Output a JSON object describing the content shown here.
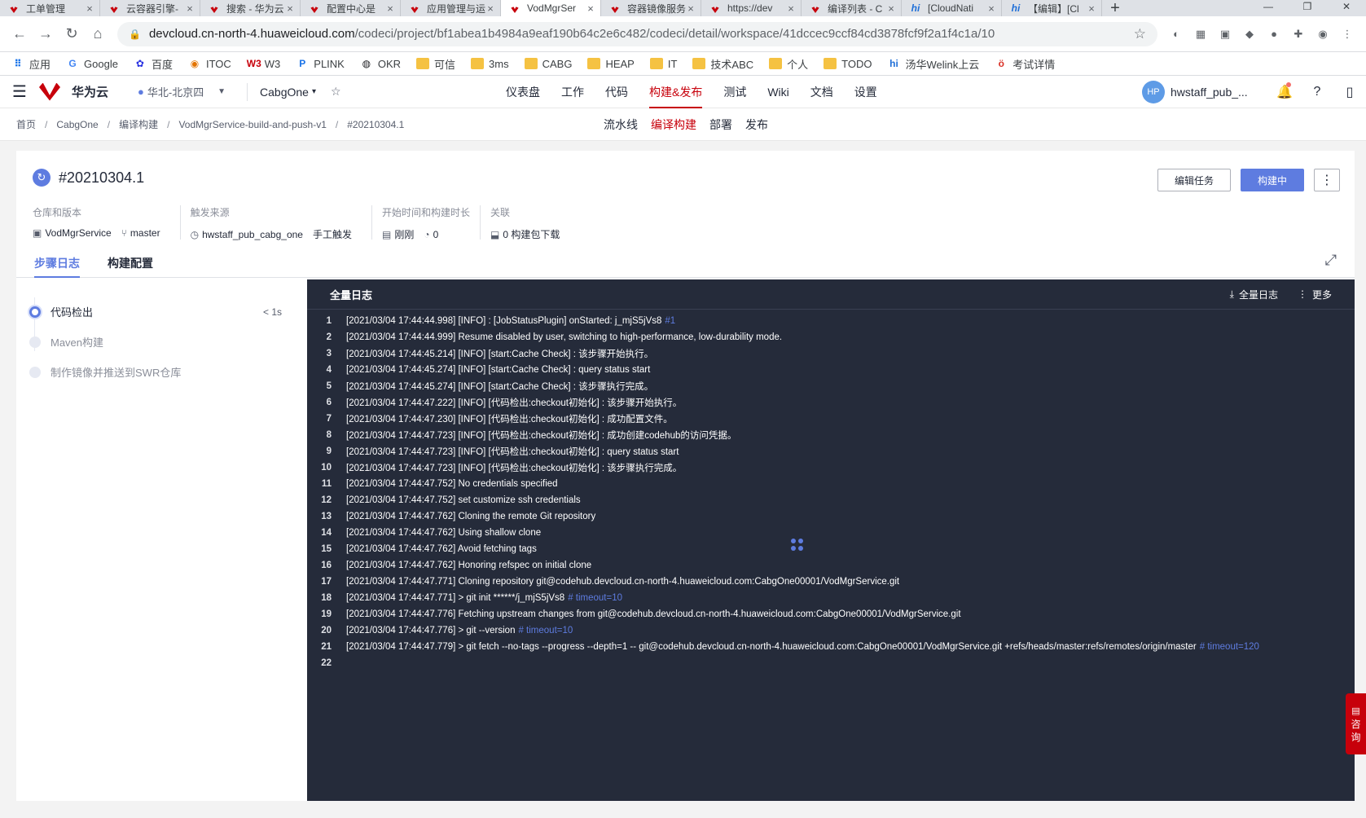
{
  "browser": {
    "tabs": [
      {
        "title": "工单管理",
        "icon": "hw",
        "active": false
      },
      {
        "title": "云容器引擎-",
        "icon": "hw",
        "active": false
      },
      {
        "title": "搜索 - 华为云",
        "icon": "hw",
        "active": false
      },
      {
        "title": "配置中心是",
        "icon": "hw",
        "active": false
      },
      {
        "title": "应用管理与运",
        "icon": "hw",
        "active": false
      },
      {
        "title": "VodMgrSer",
        "icon": "hw",
        "active": true
      },
      {
        "title": "容器镜像服务",
        "icon": "hw",
        "active": false
      },
      {
        "title": "https://dev",
        "icon": "hw",
        "active": false
      },
      {
        "title": "编译列表 - C",
        "icon": "hw",
        "active": false
      },
      {
        "title": "[CloudNati",
        "icon": "hi",
        "active": false
      },
      {
        "title": "【编辑】[Cl",
        "icon": "hi",
        "active": false
      }
    ],
    "url_domain": "devcloud.cn-north-4.huaweicloud.com",
    "url_path": "/codeci/project/bf1abea1b4984a9eaf190b64c2e6c482/codeci/detail/workspace/41dccec9ccf84cd3878fcf9f2a1f4c1a/10",
    "bookmarks": [
      {
        "label": "应用",
        "icon": "apps"
      },
      {
        "label": "Google",
        "icon": "G"
      },
      {
        "label": "百度",
        "icon": "baidu"
      },
      {
        "label": "ITOC",
        "icon": "itoc"
      },
      {
        "label": "W3",
        "icon": "W3"
      },
      {
        "label": "PLINK",
        "icon": "P"
      },
      {
        "label": "OKR",
        "icon": "okr"
      },
      {
        "label": "可信",
        "icon": "folder"
      },
      {
        "label": "3ms",
        "icon": "folder"
      },
      {
        "label": "CABG",
        "icon": "folder"
      },
      {
        "label": "HEAP",
        "icon": "folder"
      },
      {
        "label": "IT",
        "icon": "folder"
      },
      {
        "label": "技术ABC",
        "icon": "folder"
      },
      {
        "label": "个人",
        "icon": "folder"
      },
      {
        "label": "TODO",
        "icon": "folder"
      },
      {
        "label": "汤华Welink上云",
        "icon": "hi"
      },
      {
        "label": "考试详情",
        "icon": "exam"
      }
    ]
  },
  "appbar": {
    "brand": "华为云",
    "region": "华北-北京四",
    "project": "CabgOne",
    "nav": [
      "仪表盘",
      "工作",
      "代码",
      "构建&发布",
      "测试",
      "Wiki",
      "文档",
      "设置"
    ],
    "active_nav": "构建&发布",
    "avatar": "HP",
    "user": "hwstaff_pub_..."
  },
  "breadcrumb": [
    "首页",
    "CabgOne",
    "编译构建",
    "VodMgrService-build-and-push-v1",
    "#20210304.1"
  ],
  "subnav": [
    "流水线",
    "编译构建",
    "部署",
    "发布"
  ],
  "build": {
    "number": "#20210304.1",
    "edit_label": "编辑任务",
    "status_label": "构建中",
    "meta": {
      "repo_label": "仓库和版本",
      "repo": "VodMgrService",
      "branch": "master",
      "trigger_label": "触发来源",
      "trigger_user": "hwstaff_pub_cabg_one",
      "trigger_type": "手工触发",
      "time_label": "开始时间和构建时长",
      "start": "刚刚",
      "duration": "0",
      "assoc_label": "关联",
      "artifacts": "0 构建包下载"
    },
    "tabs": [
      "步骤日志",
      "构建配置"
    ],
    "steps": [
      {
        "name": "代码检出",
        "duration": "< 1s",
        "state": "running"
      },
      {
        "name": "Maven构建",
        "duration": "",
        "state": "pending"
      },
      {
        "name": "制作镜像并推送到SWR仓库",
        "duration": "",
        "state": "pending"
      }
    ]
  },
  "log": {
    "title": "全量日志",
    "download_label": "全量日志",
    "more_label": "更多",
    "lines": [
      {
        "n": "1",
        "text": "[2021/03/04 17:44:44.998] [INFO]  : [JobStatusPlugin] onStarted: j_mjS5jVs8",
        "comment": "#1"
      },
      {
        "n": "2",
        "text": "[2021/03/04 17:44:44.999] Resume disabled by user, switching to high-performance, low-durability mode.",
        "comment": ""
      },
      {
        "n": "3",
        "text": "[2021/03/04 17:44:45.214] [INFO] [start:Cache Check] : 该步骤开始执行。",
        "comment": ""
      },
      {
        "n": "4",
        "text": "[2021/03/04 17:44:45.274] [INFO] [start:Cache Check] : query status start",
        "comment": ""
      },
      {
        "n": "5",
        "text": "[2021/03/04 17:44:45.274] [INFO] [start:Cache Check] : 该步骤执行完成。",
        "comment": ""
      },
      {
        "n": "6",
        "text": "[2021/03/04 17:44:47.222] [INFO] [代码检出:checkout初始化] : 该步骤开始执行。",
        "comment": ""
      },
      {
        "n": "7",
        "text": "[2021/03/04 17:44:47.230] [INFO] [代码检出:checkout初始化] : 成功配置文件。",
        "comment": ""
      },
      {
        "n": "8",
        "text": "[2021/03/04 17:44:47.723] [INFO] [代码检出:checkout初始化] : 成功创建codehub的访问凭据。",
        "comment": ""
      },
      {
        "n": "9",
        "text": "[2021/03/04 17:44:47.723] [INFO] [代码检出:checkout初始化] : query status start",
        "comment": ""
      },
      {
        "n": "10",
        "text": "[2021/03/04 17:44:47.723] [INFO] [代码检出:checkout初始化] : 该步骤执行完成。",
        "comment": ""
      },
      {
        "n": "11",
        "text": "[2021/03/04 17:44:47.752] No credentials specified",
        "comment": ""
      },
      {
        "n": "12",
        "text": "[2021/03/04 17:44:47.752] set customize ssh credentials",
        "comment": ""
      },
      {
        "n": "13",
        "text": "[2021/03/04 17:44:47.762] Cloning the remote Git repository",
        "comment": ""
      },
      {
        "n": "14",
        "text": "[2021/03/04 17:44:47.762] Using shallow clone",
        "comment": ""
      },
      {
        "n": "15",
        "text": "[2021/03/04 17:44:47.762] Avoid fetching tags",
        "comment": ""
      },
      {
        "n": "16",
        "text": "[2021/03/04 17:44:47.762] Honoring refspec on initial clone",
        "comment": ""
      },
      {
        "n": "17",
        "text": "[2021/03/04 17:44:47.771] Cloning repository git@codehub.devcloud.cn-north-4.huaweicloud.com:CabgOne00001/VodMgrService.git",
        "comment": ""
      },
      {
        "n": "18",
        "text": "[2021/03/04 17:44:47.771]  > git init ******/j_mjS5jVs8",
        "comment": "# timeout=10"
      },
      {
        "n": "19",
        "text": "[2021/03/04 17:44:47.776] Fetching upstream changes from git@codehub.devcloud.cn-north-4.huaweicloud.com:CabgOne00001/VodMgrService.git",
        "comment": ""
      },
      {
        "n": "20",
        "text": "[2021/03/04 17:44:47.776]  > git --version",
        "comment": "# timeout=10"
      },
      {
        "n": "21",
        "text": "[2021/03/04 17:44:47.779]  > git fetch --no-tags --progress --depth=1 -- git@codehub.devcloud.cn-north-4.huaweicloud.com:CabgOne00001/VodMgrService.git +refs/heads/master:refs/remotes/origin/master",
        "comment": "# timeout=120"
      },
      {
        "n": "22",
        "text": "",
        "comment": ""
      }
    ]
  },
  "consult": [
    "咨",
    "询"
  ]
}
